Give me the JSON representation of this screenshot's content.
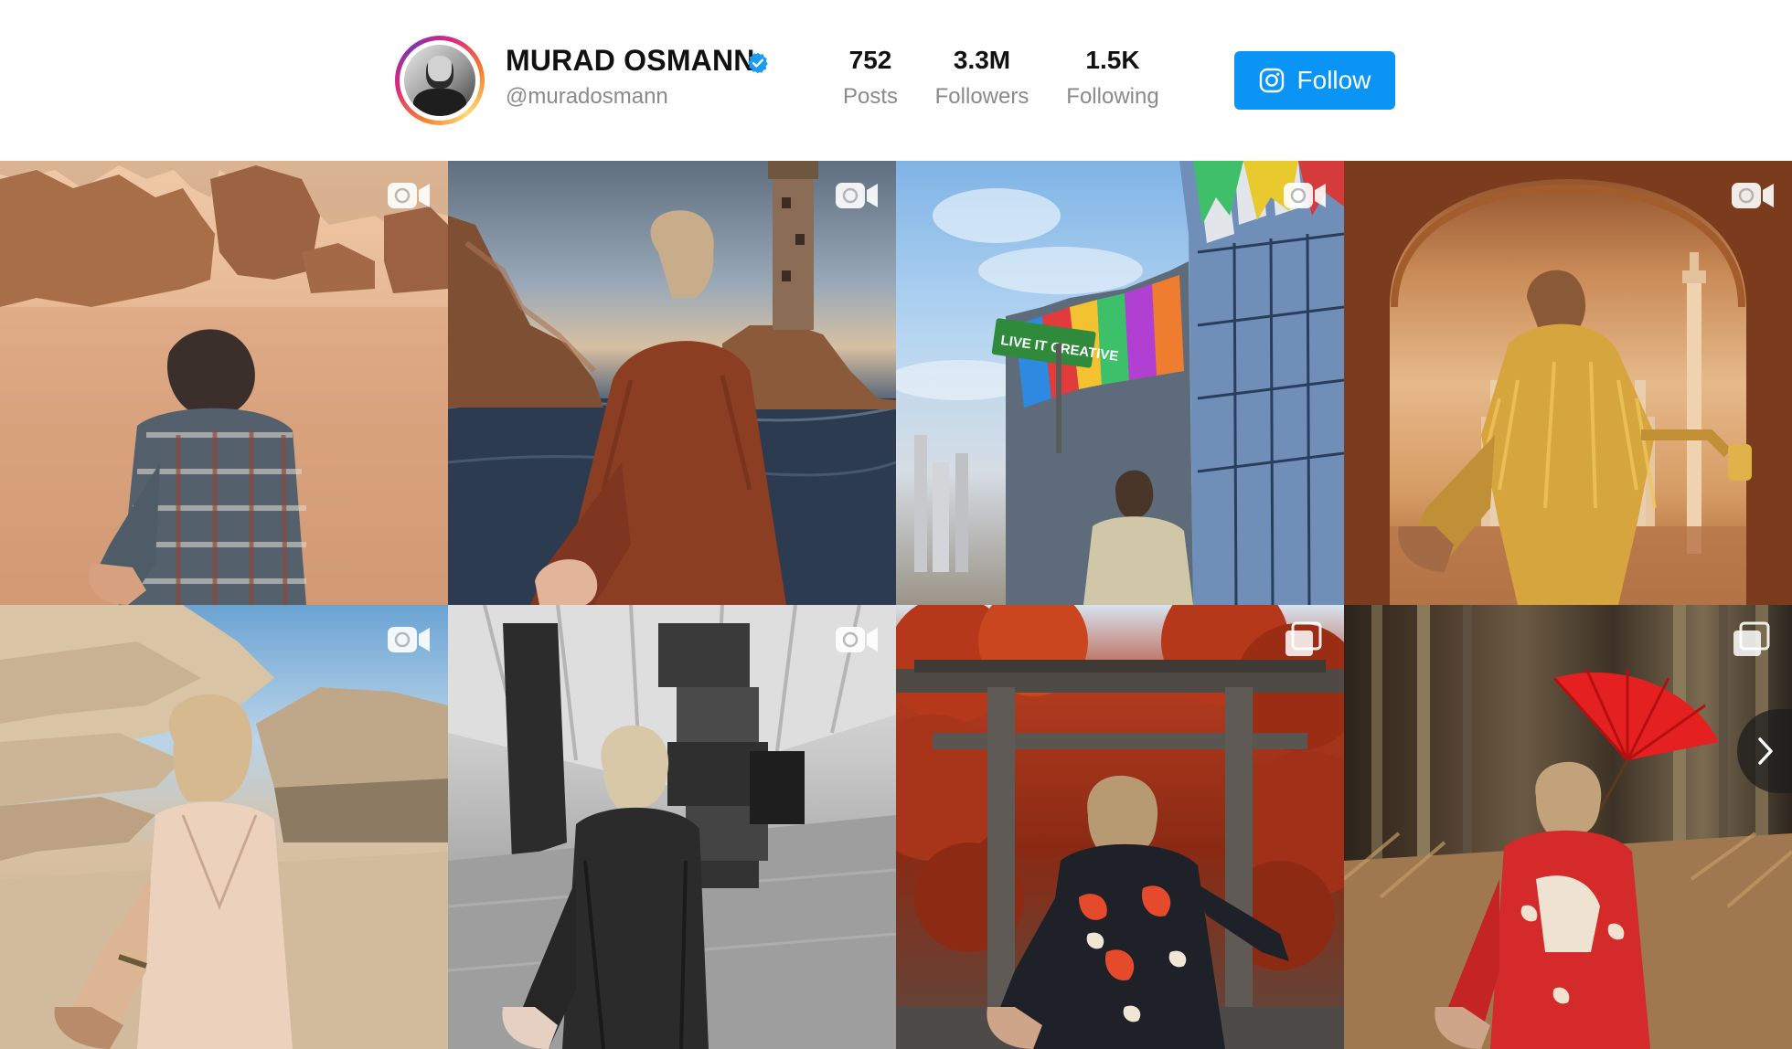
{
  "profile": {
    "name": "MURAD OSMANN",
    "handle": "@muradosmann",
    "verified": true,
    "avatar_icon": "profile-photo",
    "ring_colors": [
      "#f58529",
      "#dd2a7b",
      "#8134af",
      "#feda77"
    ]
  },
  "stats": [
    {
      "value": "752",
      "label": "Posts"
    },
    {
      "value": "3.3M",
      "label": "Followers"
    },
    {
      "value": "1.5K",
      "label": "Following"
    }
  ],
  "follow_button": {
    "label": "Follow",
    "icon": "instagram-icon",
    "color": "#0a95f6"
  },
  "posts": [
    {
      "type": "video",
      "icon": "video-camera-icon",
      "scene": "desert rock formations, person in plaid shirt"
    },
    {
      "type": "video",
      "icon": "video-camera-icon",
      "scene": "lighthouse on rocks at sea, person in rust jacket"
    },
    {
      "type": "video",
      "icon": "video-camera-icon",
      "scene": "colorful building with LIVE IT CREATIVE street sign"
    },
    {
      "type": "video",
      "icon": "video-camera-icon",
      "scene": "Taj Mahal through archway, gold fringe dress"
    },
    {
      "type": "video",
      "icon": "video-camera-icon",
      "scene": "desert rose museum, person in slip dress"
    },
    {
      "type": "video",
      "icon": "video-camera-icon",
      "scene": "airport terminal with hanging luggage"
    },
    {
      "type": "carousel",
      "icon": "carousel-icon",
      "scene": "torii gate with autumn trees, kimono"
    },
    {
      "type": "carousel",
      "icon": "carousel-icon",
      "scene": "bamboo forest, red parasol and kimono"
    }
  ],
  "street_sign": "LIVE IT CREATIVE",
  "next_arrow_icon": "chevron-right-icon",
  "colors": {
    "accent": "#0a95f6",
    "verified": "#1d9bf0",
    "muted_text": "#8a8a8a"
  }
}
